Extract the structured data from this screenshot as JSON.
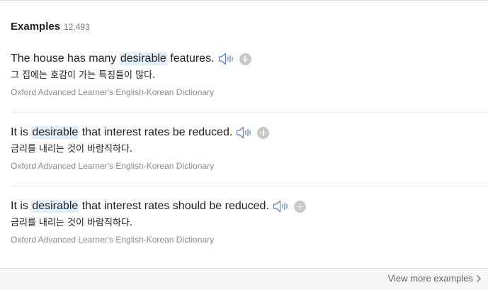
{
  "header": {
    "title": "Examples",
    "count": "12,493"
  },
  "examples": [
    {
      "before": "The house has many ",
      "highlight": "desirable",
      "after": " features.",
      "translation": "그 집에는 호감이 가는 특징들이 많다.",
      "source": "Oxford Advanced Learner's English-Korean Dictionary"
    },
    {
      "before": "It is ",
      "highlight": "desirable",
      "after": " that interest rates be reduced.",
      "translation": "금리를 내리는 것이 바람직하다.",
      "source": "Oxford Advanced Learner's English-Korean Dictionary"
    },
    {
      "before": "It is ",
      "highlight": "desirable",
      "after": " that interest rates should be reduced.",
      "translation": "금리를 내리는 것이 바람직하다.",
      "source": "Oxford Advanced Learner's English-Korean Dictionary"
    }
  ],
  "footer": {
    "view_more": "View more examples"
  },
  "icons": {
    "speaker": "speaker-icon",
    "add": "plus-circle-icon",
    "chevron": "chevron-right-icon"
  },
  "colors": {
    "highlight_bg": "#e3eefa",
    "text": "#222222",
    "muted": "#8c8c8c",
    "icon": "#5b7fc4"
  }
}
